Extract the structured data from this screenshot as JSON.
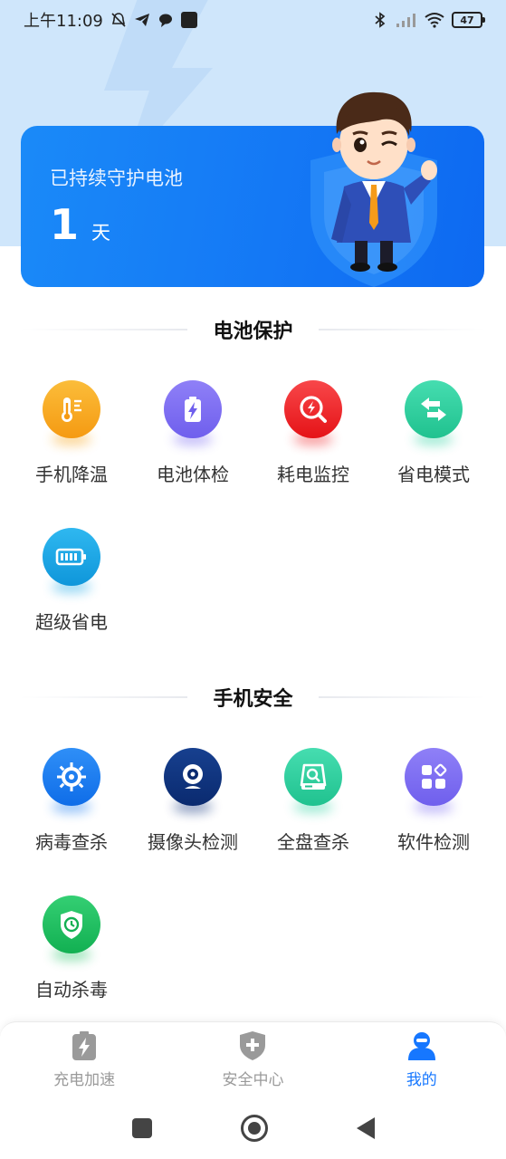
{
  "status_bar": {
    "time": "上午11:09",
    "battery": "47",
    "icons": [
      "mute-icon",
      "telegram-icon",
      "chat-bubble-icon",
      "app-square-icon",
      "bluetooth-icon",
      "signal-icon",
      "wifi-icon",
      "battery-icon"
    ]
  },
  "hero": {
    "title": "已持续守护电池",
    "days": "1",
    "unit": "天"
  },
  "battery_section": {
    "title": "电池保护",
    "items": [
      {
        "label": "手机降温",
        "icon": "thermometer-icon",
        "color": "#f7a51a"
      },
      {
        "label": "电池体检",
        "icon": "battery-check-icon",
        "color": "#7c6cf2"
      },
      {
        "label": "耗电监控",
        "icon": "power-monitor-icon",
        "color": "#f0262a"
      },
      {
        "label": "省电模式",
        "icon": "swap-arrows-icon",
        "color": "#2fd3a2"
      },
      {
        "label": "超级省电",
        "icon": "battery-full-icon",
        "color": "#1aa8e6"
      }
    ]
  },
  "security_section": {
    "title": "手机安全",
    "items": [
      {
        "label": "病毒查杀",
        "icon": "virus-icon",
        "color": "#1a7cf0"
      },
      {
        "label": "摄像头检测",
        "icon": "webcam-icon",
        "color": "#0b2e7a"
      },
      {
        "label": "全盘查杀",
        "icon": "disk-scan-icon",
        "color": "#2fd3a2"
      },
      {
        "label": "软件检测",
        "icon": "apps-icon",
        "color": "#7c6cf2"
      },
      {
        "label": "自动杀毒",
        "icon": "shield-clock-icon",
        "color": "#1ec162"
      }
    ]
  },
  "tabbar": {
    "tabs": [
      {
        "label": "充电加速",
        "icon": "charge-icon",
        "active": false
      },
      {
        "label": "安全中心",
        "icon": "shield-plus-icon",
        "active": false
      },
      {
        "label": "我的",
        "icon": "user-icon",
        "active": true
      }
    ]
  },
  "colors": {
    "accent": "#1677ff",
    "hero_bg": "#1478f5",
    "top_bg": "#cfe6fb"
  }
}
